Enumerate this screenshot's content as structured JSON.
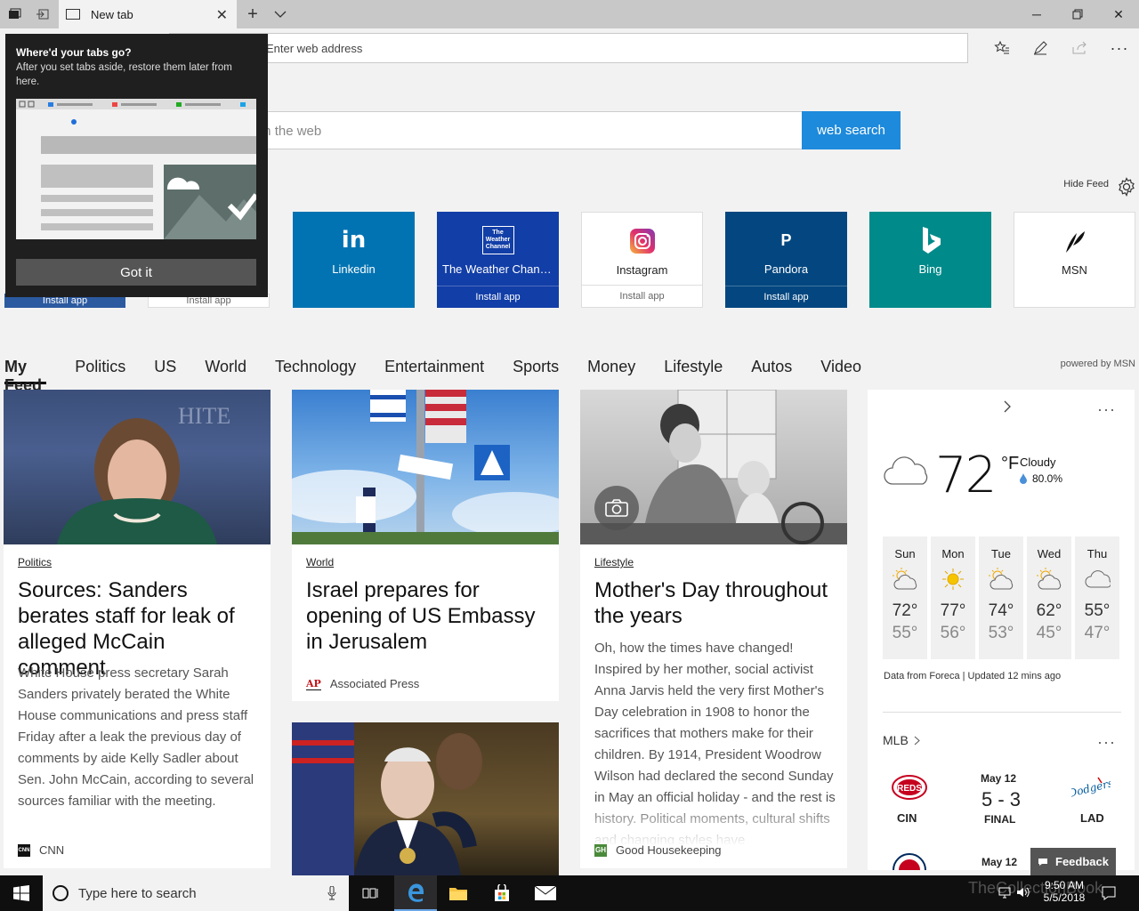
{
  "browser": {
    "tab_title": "New tab",
    "address_placeholder": "Enter web address"
  },
  "search": {
    "placeholder": "Search the web",
    "button": "web search"
  },
  "hide_feed": "Hide Feed",
  "tiles": [
    {
      "label": "Linkedin",
      "logo": "in",
      "install": "",
      "color": "#0173b2"
    },
    {
      "label": "The Weather Channel",
      "logo": "The Weather Channel",
      "install": "Install app",
      "color": "#123ea7"
    },
    {
      "label": "Instagram",
      "logo": "instagram-icon",
      "install": "Install app",
      "color": "#ffffff"
    },
    {
      "label": "Pandora",
      "logo": "P",
      "install": "Install app",
      "color": "#044780"
    },
    {
      "label": "Bing",
      "logo": "bing-icon",
      "install": "",
      "color": "#008a8a"
    },
    {
      "label": "MSN",
      "logo": "msn-icon",
      "install": "",
      "color": "#ffffff"
    }
  ],
  "hidden_tiles_install": [
    "Install app",
    "Install app"
  ],
  "categories": [
    "My Feed",
    "Politics",
    "US",
    "World",
    "Technology",
    "Entertainment",
    "Sports",
    "Money",
    "Lifestyle",
    "Autos",
    "Video"
  ],
  "powered_by": "powered by MSN",
  "cards": [
    {
      "category": "Politics",
      "headline": "Sources: Sanders berates staff for leak of alleged McCain comment",
      "summary": "White House press secretary Sarah Sanders privately berated the White House communications and press staff Friday after a leak the previous day of comments by aide Kelly Sadler about Sen. John McCain, according to several sources familiar with the meeting.",
      "source": "CNN"
    },
    {
      "category": "World",
      "headline": "Israel prepares for opening of US Embassy in Jerusalem",
      "summary": "",
      "source": "Associated Press"
    },
    {
      "category": "Lifestyle",
      "headline": "Mother's Day throughout the years",
      "summary": "Oh, how the times have changed! Inspired by her mother, social activist Anna Jarvis held the very first Mother's Day celebration in 1908 to honor the sacrifices that mothers make for their children. By 1914, President Woodrow Wilson had declared the second Sunday in May an official holiday - and the rest is history. Political moments, cultural shifts and changing styles have",
      "source": "Good Housekeeping"
    }
  ],
  "weather": {
    "temp": "72",
    "unit": "°F",
    "condition": "Cloudy",
    "precip": "80.0%",
    "forecast": [
      {
        "day": "Sun",
        "hi": "72°",
        "lo": "55°",
        "icon": "partly-cloudy-icon"
      },
      {
        "day": "Mon",
        "hi": "77°",
        "lo": "56°",
        "icon": "sun-icon"
      },
      {
        "day": "Tue",
        "hi": "74°",
        "lo": "53°",
        "icon": "partly-cloudy-icon"
      },
      {
        "day": "Wed",
        "hi": "62°",
        "lo": "45°",
        "icon": "partly-cloudy-icon"
      },
      {
        "day": "Thu",
        "hi": "55°",
        "lo": "47°",
        "icon": "cloud-icon"
      }
    ],
    "data_source": "Data from Foreca | Updated 12 mins ago"
  },
  "mlb": {
    "title": "MLB",
    "game1": {
      "date": "May 12",
      "score": "5 - 3",
      "status": "FINAL",
      "home": "CIN",
      "away": "LAD"
    },
    "game2": {
      "date": "May 12"
    }
  },
  "feedback": "Feedback",
  "popup": {
    "title": "Where'd your tabs go?",
    "body": "After you set tabs aside, restore them later from here.",
    "button": "Got it"
  },
  "taskbar": {
    "search_placeholder": "Type here to search",
    "time": "9:50 AM",
    "date": "5/5/2018"
  },
  "watermark": "TheCollectionBook"
}
